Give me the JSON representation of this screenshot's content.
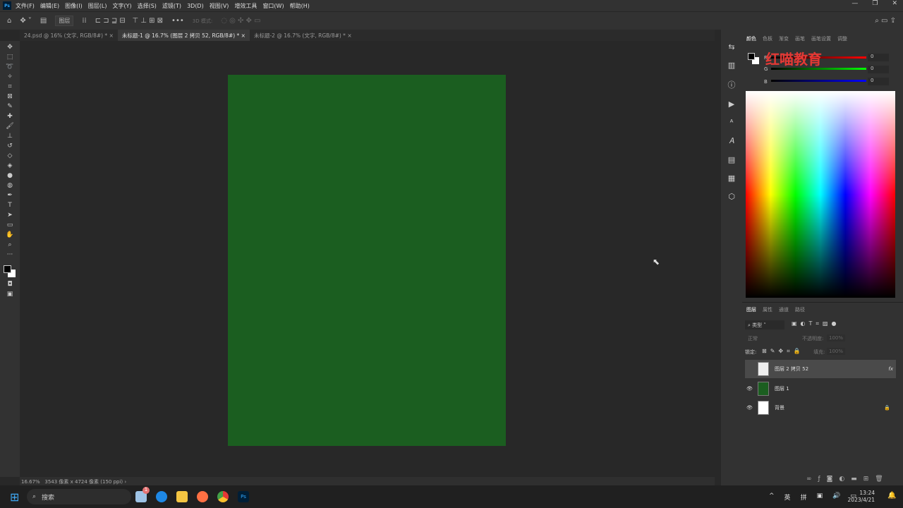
{
  "menu": {
    "app_icon": "Ps",
    "items": [
      "文件(F)",
      "编辑(E)",
      "图像(I)",
      "图层(L)",
      "文字(Y)",
      "选择(S)",
      "滤镜(T)",
      "3D(D)",
      "视图(V)",
      "增效工具",
      "窗口(W)",
      "帮助(H)"
    ]
  },
  "options": {
    "layer_select": "图层",
    "mode_3d": "3D 模式:"
  },
  "tabs": [
    {
      "label": "24.psd @ 16% (文字, RGB/8#) *",
      "active": false
    },
    {
      "label": "未标题-1 @ 16.7% (图层 2 拷贝 52, RGB/8#) *",
      "active": true
    },
    {
      "label": "未标题-2 @ 16.7% (文字, RGB/8#) *",
      "active": false
    }
  ],
  "status": {
    "zoom": "16.67%",
    "info": "3543 像素 x 4724 像素 (150 ppi)"
  },
  "color_panel": {
    "tabs": [
      "颜色",
      "色板",
      "渐变",
      "画笔",
      "画笔设置",
      "调整"
    ],
    "channels": [
      {
        "label": "R",
        "value": "0"
      },
      {
        "label": "G",
        "value": "0"
      },
      {
        "label": "B",
        "value": "0"
      }
    ]
  },
  "watermark": "红喵教育",
  "layers_panel": {
    "tabs": [
      "图层",
      "属性",
      "通道",
      "路径"
    ],
    "filter": "类型",
    "blend_mode": "正常",
    "opacity_label": "不透明度:",
    "opacity": "100%",
    "lock_label": "锁定:",
    "fill_label": "填充:",
    "fill": "100%",
    "layers": [
      {
        "name": "图层 2 拷贝 52",
        "visible": false,
        "fx": "fx",
        "selected": true
      },
      {
        "name": "图层 1",
        "visible": true,
        "color": "#1b5e20"
      },
      {
        "name": "背景",
        "visible": true,
        "locked": true
      }
    ]
  },
  "document": {
    "fill_color": "#1b5e20"
  },
  "taskbar": {
    "search": "搜索",
    "badge": "1",
    "ime1": "英",
    "ime2": "拼",
    "time": "13:24",
    "date": "2023/4/21"
  }
}
